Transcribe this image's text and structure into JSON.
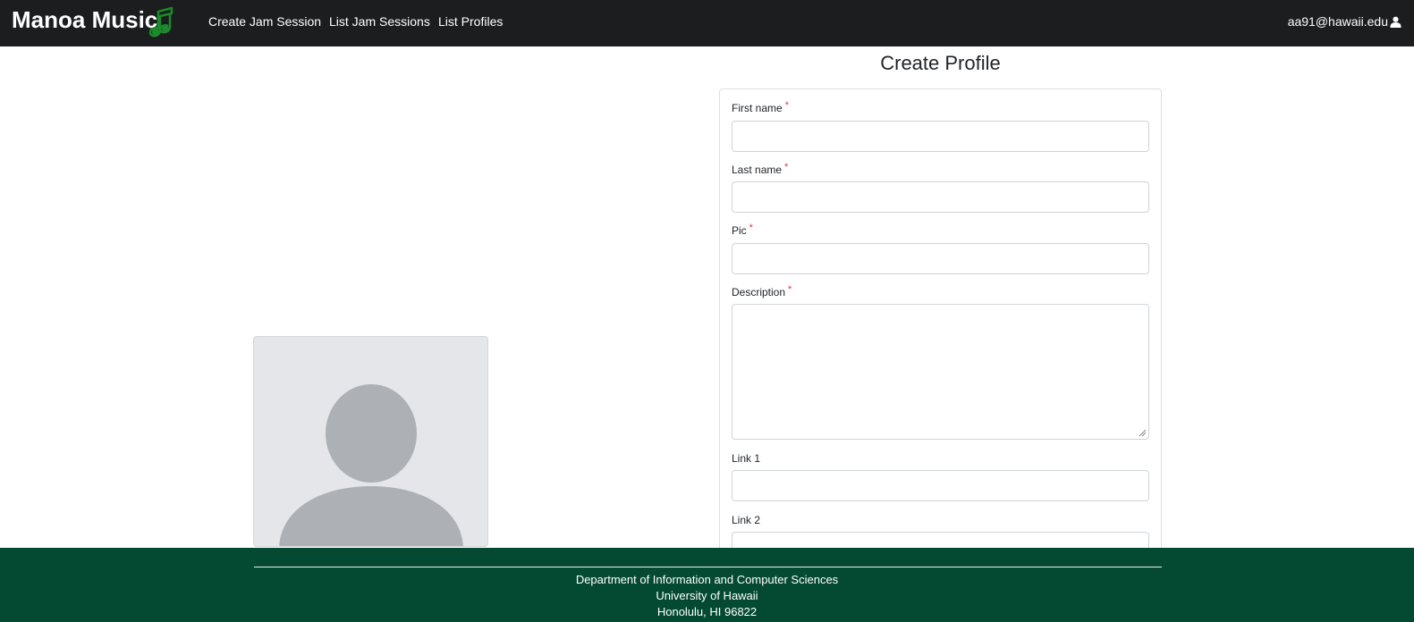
{
  "navbar": {
    "brand": "Manoa Music",
    "brand_icon": "music-note-icon",
    "links": [
      "Create Jam Session",
      "List Jam Sessions",
      "List Profiles"
    ],
    "user_email": "aa91@hawaii.edu",
    "user_icon": "user-icon"
  },
  "avatar": {
    "icon": "default-avatar-icon"
  },
  "form": {
    "title": "Create Profile",
    "required_mark": "*",
    "fields": [
      {
        "label": "First name",
        "value": "",
        "required": true
      },
      {
        "label": "Last name",
        "value": "",
        "required": true
      },
      {
        "label": "Pic",
        "value": "",
        "required": true
      },
      {
        "label": "Description",
        "value": "",
        "required": true
      },
      {
        "label": "Link 1",
        "value": "",
        "required": false
      },
      {
        "label": "Link 2",
        "value": "",
        "required": false
      }
    ]
  },
  "footer": {
    "lines": [
      "Department of Information and Computer Sciences",
      "University of Hawaii",
      "Honolulu, HI 96822"
    ]
  },
  "colors": {
    "navbar_bg": "#1c1d1f",
    "footer_bg": "#044a33",
    "brand_accent": "#1a8a2a",
    "required": "#dc3545"
  }
}
